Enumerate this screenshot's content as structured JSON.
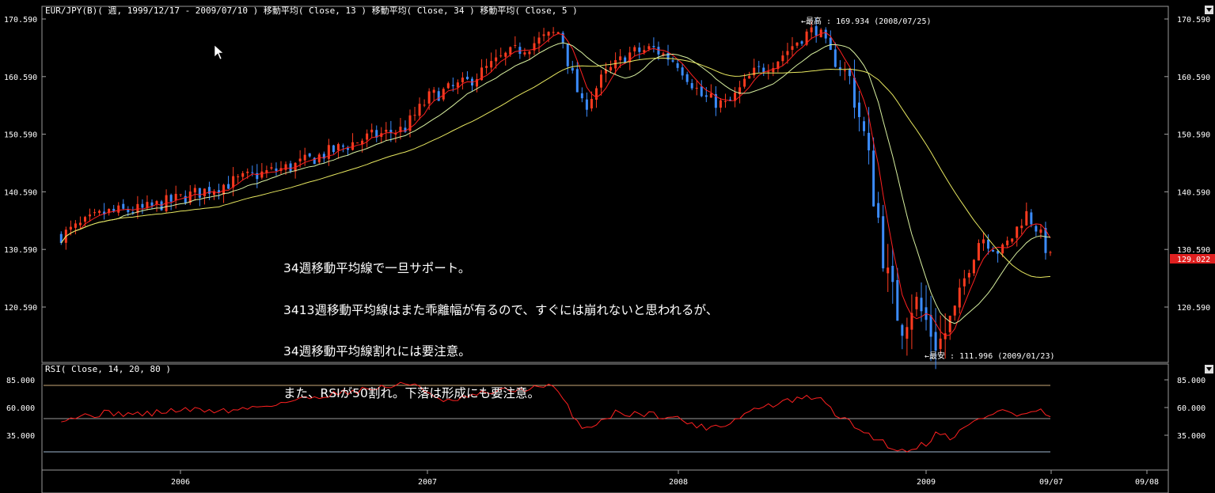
{
  "header": {
    "main_title": "EUR/JPY(B)( 週, 1999/12/17 - 2009/07/10 )   移動平均( Close, 13 )   移動平均( Close, 34 )   移動平均( Close, 5 )",
    "rsi_title": "RSI( Close, 14, 20, 80 )"
  },
  "annotation": {
    "line1": "34週移動平均線で一旦サポート。",
    "line2": "3413週移動平均線はまた乖離幅が有るので、すぐには崩れないと思われるが、",
    "line3": "34週移動平均線割れには要注意。",
    "line4": "また、RSIが50割れ。下落は形成にも要注意。"
  },
  "markers": {
    "high_label": "←最高 : 169.934 (2008/07/25)",
    "low_label": "←最安 : 111.996 (2009/01/23)",
    "last_price": "129.022"
  },
  "colors": {
    "background": "#000000",
    "up_candle": "#ff3b1f",
    "down_candle": "#3b8cff",
    "ma5": "#ff2020",
    "ma13": "#d8f0a0",
    "ma34": "#e8e860",
    "rsi": "#ff2020",
    "grid": "#a0a0a0",
    "last_price_bg": "#e02020"
  },
  "chart_data": [
    {
      "type": "candlestick",
      "title": "EUR/JPY(B)( 週, 1999/12/17 - 2009/07/10 )",
      "series": [
        {
          "name": "移動平均( Close, 13 )"
        },
        {
          "name": "移動平均( Close, 34 )"
        },
        {
          "name": "移動平均( Close, 5 )"
        }
      ],
      "ylim": [
        111.0,
        171.5
      ],
      "yticks": [
        "170.590",
        "160.590",
        "150.590",
        "140.590",
        "130.590",
        "120.590"
      ],
      "xticks": [
        "2006",
        "2007",
        "2008",
        "2009",
        "09/07",
        "09/08"
      ],
      "close_path": [
        [
          2005.52,
          133.0
        ],
        [
          2005.7,
          137.0
        ],
        [
          2005.85,
          137.5
        ],
        [
          2006.0,
          139.5
        ],
        [
          2006.15,
          141.5
        ],
        [
          2006.3,
          143.5
        ],
        [
          2006.45,
          145.0
        ],
        [
          2006.6,
          147.5
        ],
        [
          2006.75,
          150.0
        ],
        [
          2006.9,
          151.5
        ],
        [
          2007.0,
          157.0
        ],
        [
          2007.15,
          159.5
        ],
        [
          2007.3,
          164.0
        ],
        [
          2007.45,
          167.0
        ],
        [
          2007.53,
          168.5
        ],
        [
          2007.56,
          163.0
        ],
        [
          2007.62,
          155.0
        ],
        [
          2007.7,
          160.5
        ],
        [
          2007.8,
          164.5
        ],
        [
          2007.9,
          165.5
        ],
        [
          2008.0,
          163.0
        ],
        [
          2008.1,
          157.0
        ],
        [
          2008.2,
          155.5
        ],
        [
          2008.3,
          161.0
        ],
        [
          2008.4,
          163.5
        ],
        [
          2008.5,
          167.5
        ],
        [
          2008.56,
          169.0
        ],
        [
          2008.62,
          164.0
        ],
        [
          2008.7,
          160.0
        ],
        [
          2008.75,
          150.0
        ],
        [
          2008.8,
          138.0
        ],
        [
          2008.85,
          124.0
        ],
        [
          2008.9,
          118.0
        ],
        [
          2008.95,
          122.0
        ],
        [
          2009.0,
          118.0
        ],
        [
          2009.05,
          114.0
        ],
        [
          2009.1,
          118.0
        ],
        [
          2009.15,
          125.0
        ],
        [
          2009.22,
          133.0
        ],
        [
          2009.3,
          130.0
        ],
        [
          2009.35,
          133.0
        ],
        [
          2009.4,
          137.0
        ],
        [
          2009.45,
          134.0
        ],
        [
          2009.5,
          129.0
        ]
      ],
      "high": {
        "value": 169.934,
        "date": "2008/07/25"
      },
      "low": {
        "value": 111.996,
        "date": "2009/01/23"
      },
      "last": 129.022
    },
    {
      "type": "line",
      "title": "RSI( Close, 14, 20, 80 )",
      "ylim": [
        20,
        85
      ],
      "yticks": [
        "85.000",
        "60.000",
        "35.000"
      ],
      "levels": [
        80,
        50,
        20
      ],
      "path": [
        [
          2005.52,
          50
        ],
        [
          2005.7,
          55
        ],
        [
          2005.85,
          54
        ],
        [
          2006.0,
          58
        ],
        [
          2006.2,
          57
        ],
        [
          2006.4,
          64
        ],
        [
          2006.6,
          72
        ],
        [
          2006.8,
          78
        ],
        [
          2006.95,
          82
        ],
        [
          2007.05,
          64
        ],
        [
          2007.25,
          74
        ],
        [
          2007.5,
          79
        ],
        [
          2007.56,
          60
        ],
        [
          2007.62,
          40
        ],
        [
          2007.75,
          55
        ],
        [
          2007.9,
          54
        ],
        [
          2008.0,
          50
        ],
        [
          2008.1,
          42
        ],
        [
          2008.2,
          45
        ],
        [
          2008.3,
          58
        ],
        [
          2008.45,
          66
        ],
        [
          2008.56,
          70
        ],
        [
          2008.65,
          52
        ],
        [
          2008.75,
          38
        ],
        [
          2008.85,
          26
        ],
        [
          2008.9,
          20
        ],
        [
          2009.0,
          28
        ],
        [
          2009.05,
          38
        ],
        [
          2009.1,
          33
        ],
        [
          2009.2,
          48
        ],
        [
          2009.3,
          58
        ],
        [
          2009.38,
          52
        ],
        [
          2009.45,
          58
        ],
        [
          2009.5,
          49
        ]
      ]
    }
  ]
}
